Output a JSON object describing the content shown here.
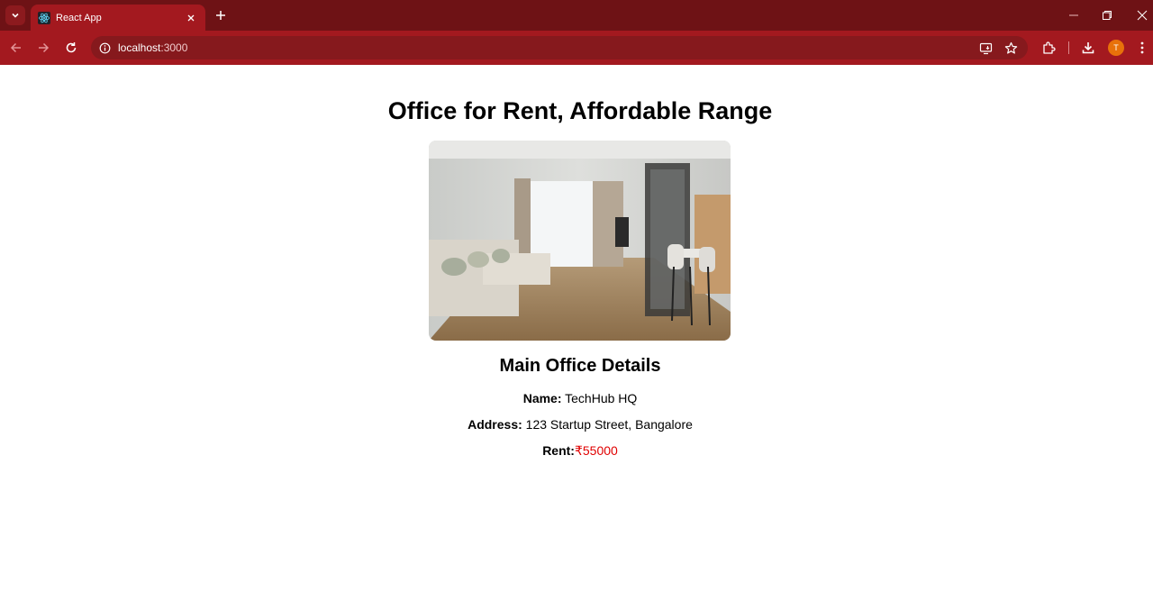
{
  "browser": {
    "tab_title": "React App",
    "url_host": "localhost",
    "url_port": ":3000",
    "profile_initial": "T"
  },
  "page": {
    "title": "Office for Rent, Affordable Range",
    "image_alt": "",
    "section_title": "Main Office Details",
    "name_label": "Name:",
    "name_value": " TechHub HQ",
    "address_label": "Address:",
    "address_value": " 123 Startup Street, Bangalore",
    "rent_label": "Rent:",
    "rent_value": "₹55000"
  },
  "colors": {
    "tabstrip": "#6e1215",
    "toolbar": "#a3191f",
    "rent_value": "#e00000"
  }
}
